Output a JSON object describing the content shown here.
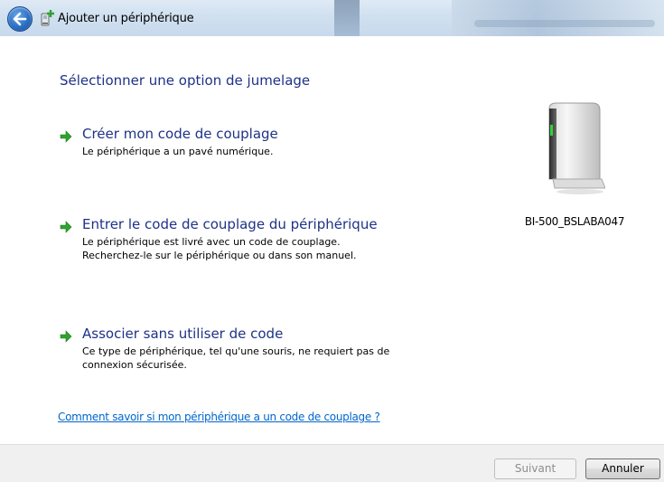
{
  "window": {
    "title": "Ajouter un périphérique"
  },
  "main": {
    "heading": "Sélectionner une option de jumelage",
    "options": [
      {
        "title": "Créer mon code de couplage",
        "description": "Le périphérique a un pavé numérique."
      },
      {
        "title": "Entrer le code de couplage du périphérique",
        "description_line1": "Le périphérique est livré avec un code de couplage.",
        "description_line2": "Recherchez-le sur le périphérique ou dans son manuel."
      },
      {
        "title": "Associer sans utiliser de code",
        "description_line1": "Ce type de périphérique, tel qu'une souris, ne requiert pas de",
        "description_line2": "connexion sécurisée."
      }
    ],
    "device": {
      "name": "BI-500_BSLABA047",
      "icon": "storage-device-icon"
    },
    "help_link": "Comment savoir si mon périphérique a un code de couplage ?"
  },
  "footer": {
    "next_label": "Suivant",
    "next_enabled": false,
    "cancel_label": "Annuler"
  },
  "colors": {
    "heading": "#1e3287",
    "link": "#0066cc",
    "arrow": "#2ea32e",
    "footer_bg": "#f0f0f0"
  }
}
